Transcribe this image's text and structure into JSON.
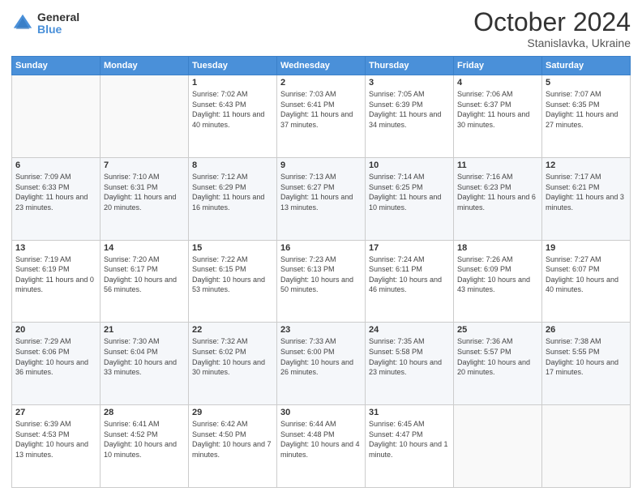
{
  "header": {
    "logo": {
      "general": "General",
      "blue": "Blue"
    },
    "title": "October 2024",
    "location": "Stanislavka, Ukraine"
  },
  "weekdays": [
    "Sunday",
    "Monday",
    "Tuesday",
    "Wednesday",
    "Thursday",
    "Friday",
    "Saturday"
  ],
  "weeks": [
    [
      {
        "day": "",
        "sunrise": "",
        "sunset": "",
        "daylight": ""
      },
      {
        "day": "",
        "sunrise": "",
        "sunset": "",
        "daylight": ""
      },
      {
        "day": "1",
        "sunrise": "Sunrise: 7:02 AM",
        "sunset": "Sunset: 6:43 PM",
        "daylight": "Daylight: 11 hours and 40 minutes."
      },
      {
        "day": "2",
        "sunrise": "Sunrise: 7:03 AM",
        "sunset": "Sunset: 6:41 PM",
        "daylight": "Daylight: 11 hours and 37 minutes."
      },
      {
        "day": "3",
        "sunrise": "Sunrise: 7:05 AM",
        "sunset": "Sunset: 6:39 PM",
        "daylight": "Daylight: 11 hours and 34 minutes."
      },
      {
        "day": "4",
        "sunrise": "Sunrise: 7:06 AM",
        "sunset": "Sunset: 6:37 PM",
        "daylight": "Daylight: 11 hours and 30 minutes."
      },
      {
        "day": "5",
        "sunrise": "Sunrise: 7:07 AM",
        "sunset": "Sunset: 6:35 PM",
        "daylight": "Daylight: 11 hours and 27 minutes."
      }
    ],
    [
      {
        "day": "6",
        "sunrise": "Sunrise: 7:09 AM",
        "sunset": "Sunset: 6:33 PM",
        "daylight": "Daylight: 11 hours and 23 minutes."
      },
      {
        "day": "7",
        "sunrise": "Sunrise: 7:10 AM",
        "sunset": "Sunset: 6:31 PM",
        "daylight": "Daylight: 11 hours and 20 minutes."
      },
      {
        "day": "8",
        "sunrise": "Sunrise: 7:12 AM",
        "sunset": "Sunset: 6:29 PM",
        "daylight": "Daylight: 11 hours and 16 minutes."
      },
      {
        "day": "9",
        "sunrise": "Sunrise: 7:13 AM",
        "sunset": "Sunset: 6:27 PM",
        "daylight": "Daylight: 11 hours and 13 minutes."
      },
      {
        "day": "10",
        "sunrise": "Sunrise: 7:14 AM",
        "sunset": "Sunset: 6:25 PM",
        "daylight": "Daylight: 11 hours and 10 minutes."
      },
      {
        "day": "11",
        "sunrise": "Sunrise: 7:16 AM",
        "sunset": "Sunset: 6:23 PM",
        "daylight": "Daylight: 11 hours and 6 minutes."
      },
      {
        "day": "12",
        "sunrise": "Sunrise: 7:17 AM",
        "sunset": "Sunset: 6:21 PM",
        "daylight": "Daylight: 11 hours and 3 minutes."
      }
    ],
    [
      {
        "day": "13",
        "sunrise": "Sunrise: 7:19 AM",
        "sunset": "Sunset: 6:19 PM",
        "daylight": "Daylight: 11 hours and 0 minutes."
      },
      {
        "day": "14",
        "sunrise": "Sunrise: 7:20 AM",
        "sunset": "Sunset: 6:17 PM",
        "daylight": "Daylight: 10 hours and 56 minutes."
      },
      {
        "day": "15",
        "sunrise": "Sunrise: 7:22 AM",
        "sunset": "Sunset: 6:15 PM",
        "daylight": "Daylight: 10 hours and 53 minutes."
      },
      {
        "day": "16",
        "sunrise": "Sunrise: 7:23 AM",
        "sunset": "Sunset: 6:13 PM",
        "daylight": "Daylight: 10 hours and 50 minutes."
      },
      {
        "day": "17",
        "sunrise": "Sunrise: 7:24 AM",
        "sunset": "Sunset: 6:11 PM",
        "daylight": "Daylight: 10 hours and 46 minutes."
      },
      {
        "day": "18",
        "sunrise": "Sunrise: 7:26 AM",
        "sunset": "Sunset: 6:09 PM",
        "daylight": "Daylight: 10 hours and 43 minutes."
      },
      {
        "day": "19",
        "sunrise": "Sunrise: 7:27 AM",
        "sunset": "Sunset: 6:07 PM",
        "daylight": "Daylight: 10 hours and 40 minutes."
      }
    ],
    [
      {
        "day": "20",
        "sunrise": "Sunrise: 7:29 AM",
        "sunset": "Sunset: 6:06 PM",
        "daylight": "Daylight: 10 hours and 36 minutes."
      },
      {
        "day": "21",
        "sunrise": "Sunrise: 7:30 AM",
        "sunset": "Sunset: 6:04 PM",
        "daylight": "Daylight: 10 hours and 33 minutes."
      },
      {
        "day": "22",
        "sunrise": "Sunrise: 7:32 AM",
        "sunset": "Sunset: 6:02 PM",
        "daylight": "Daylight: 10 hours and 30 minutes."
      },
      {
        "day": "23",
        "sunrise": "Sunrise: 7:33 AM",
        "sunset": "Sunset: 6:00 PM",
        "daylight": "Daylight: 10 hours and 26 minutes."
      },
      {
        "day": "24",
        "sunrise": "Sunrise: 7:35 AM",
        "sunset": "Sunset: 5:58 PM",
        "daylight": "Daylight: 10 hours and 23 minutes."
      },
      {
        "day": "25",
        "sunrise": "Sunrise: 7:36 AM",
        "sunset": "Sunset: 5:57 PM",
        "daylight": "Daylight: 10 hours and 20 minutes."
      },
      {
        "day": "26",
        "sunrise": "Sunrise: 7:38 AM",
        "sunset": "Sunset: 5:55 PM",
        "daylight": "Daylight: 10 hours and 17 minutes."
      }
    ],
    [
      {
        "day": "27",
        "sunrise": "Sunrise: 6:39 AM",
        "sunset": "Sunset: 4:53 PM",
        "daylight": "Daylight: 10 hours and 13 minutes."
      },
      {
        "day": "28",
        "sunrise": "Sunrise: 6:41 AM",
        "sunset": "Sunset: 4:52 PM",
        "daylight": "Daylight: 10 hours and 10 minutes."
      },
      {
        "day": "29",
        "sunrise": "Sunrise: 6:42 AM",
        "sunset": "Sunset: 4:50 PM",
        "daylight": "Daylight: 10 hours and 7 minutes."
      },
      {
        "day": "30",
        "sunrise": "Sunrise: 6:44 AM",
        "sunset": "Sunset: 4:48 PM",
        "daylight": "Daylight: 10 hours and 4 minutes."
      },
      {
        "day": "31",
        "sunrise": "Sunrise: 6:45 AM",
        "sunset": "Sunset: 4:47 PM",
        "daylight": "Daylight: 10 hours and 1 minute."
      },
      {
        "day": "",
        "sunrise": "",
        "sunset": "",
        "daylight": ""
      },
      {
        "day": "",
        "sunrise": "",
        "sunset": "",
        "daylight": ""
      }
    ]
  ]
}
